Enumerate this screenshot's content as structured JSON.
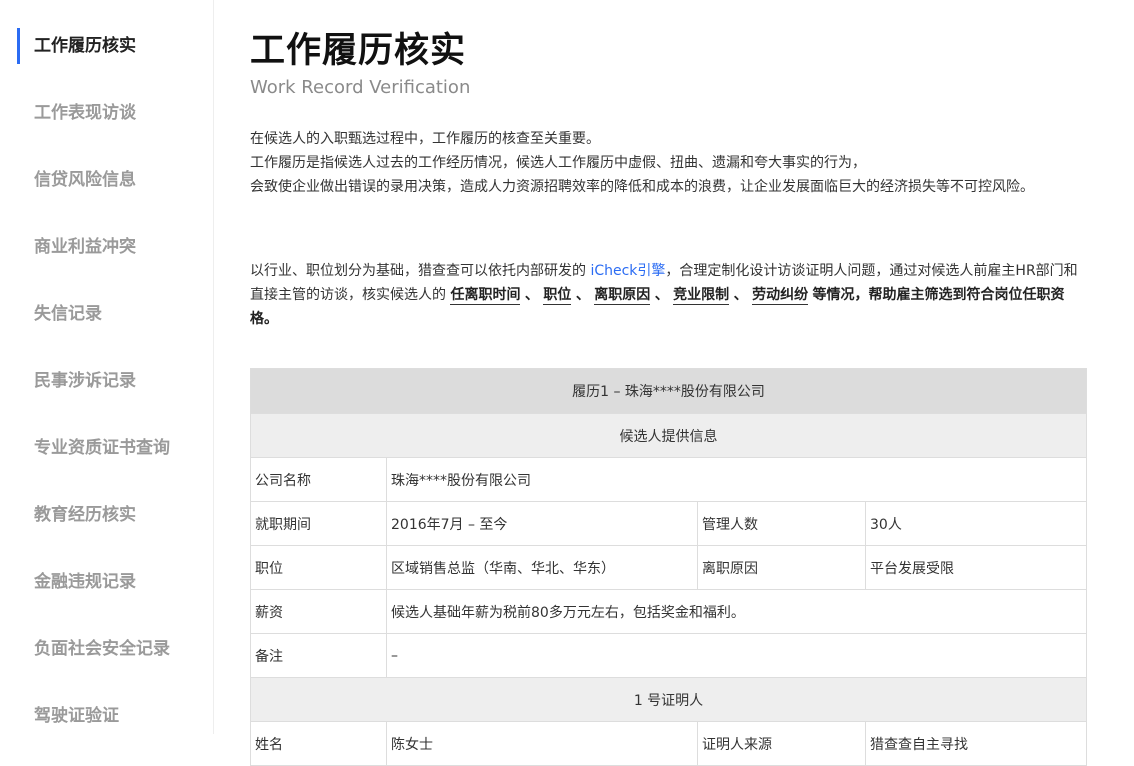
{
  "sidebar": {
    "items": [
      {
        "label": "工作履历核实",
        "active": true
      },
      {
        "label": "工作表现访谈"
      },
      {
        "label": "信贷风险信息"
      },
      {
        "label": "商业利益冲突"
      },
      {
        "label": "失信记录"
      },
      {
        "label": "民事涉诉记录"
      },
      {
        "label": "专业资质证书查询"
      },
      {
        "label": "教育经历核实"
      },
      {
        "label": "金融违规记录"
      },
      {
        "label": "负面社会安全记录"
      },
      {
        "label": "驾驶证验证"
      }
    ],
    "accent_color": "#2b6cf3"
  },
  "main": {
    "title": "工作履历核实",
    "subtitle": "Work Record Verification",
    "intro": {
      "line1": "在候选人的入职甄选过程中，工作履历的核查至关重要。",
      "line2": "工作履历是指候选人过去的工作经历情况，候选人工作履历中虚假、扭曲、遗漏和夸大事实的行为，",
      "line3": "会致使企业做出错误的录用决策，造成人力资源招聘效率的降低和成本的浪费，让企业发展面临巨大的经济损失等不可控风险。"
    },
    "method": {
      "part1": "以行业、职位划分为基础，猎查查可以依托内部研发的",
      "link": "iCheck引擎",
      "part2": "，合理定制化设计访谈证明人问题，通过对候选人前雇主HR部门和直接主管的访谈，核实候选人的",
      "kw1": "任离职时间",
      "sep": "、",
      "kw2": "职位",
      "kw3": "离职原因",
      "kw4": "竞业限制",
      "kw5": "劳动纠纷",
      "part3": "等情况，帮助雇主筛选到符合岗位任职资格。"
    },
    "record": {
      "title": "履历1 – 珠海****股份有限公司",
      "section1": "候选人提供信息",
      "company_label": "公司名称",
      "company_value": "珠海****股份有限公司",
      "period_label": "就职期间",
      "period_value": "2016年7月 –  至今",
      "manage_label": "管理人数",
      "manage_value": "30人",
      "position_label": "职位",
      "position_value": "区域销售总监（华南、华北、华东）",
      "leave_label": "离职原因",
      "leave_value": "平台发展受限",
      "salary_label": "薪资",
      "salary_value": "候选人基础年薪为税前80多万元左右，包括奖金和福利。",
      "note_label": "备注",
      "note_value": "–",
      "section2": "1 号证明人",
      "name_label": "姓名",
      "name_value": "陈女士",
      "source_label": "证明人来源",
      "source_value": "猎查查自主寻找"
    }
  }
}
